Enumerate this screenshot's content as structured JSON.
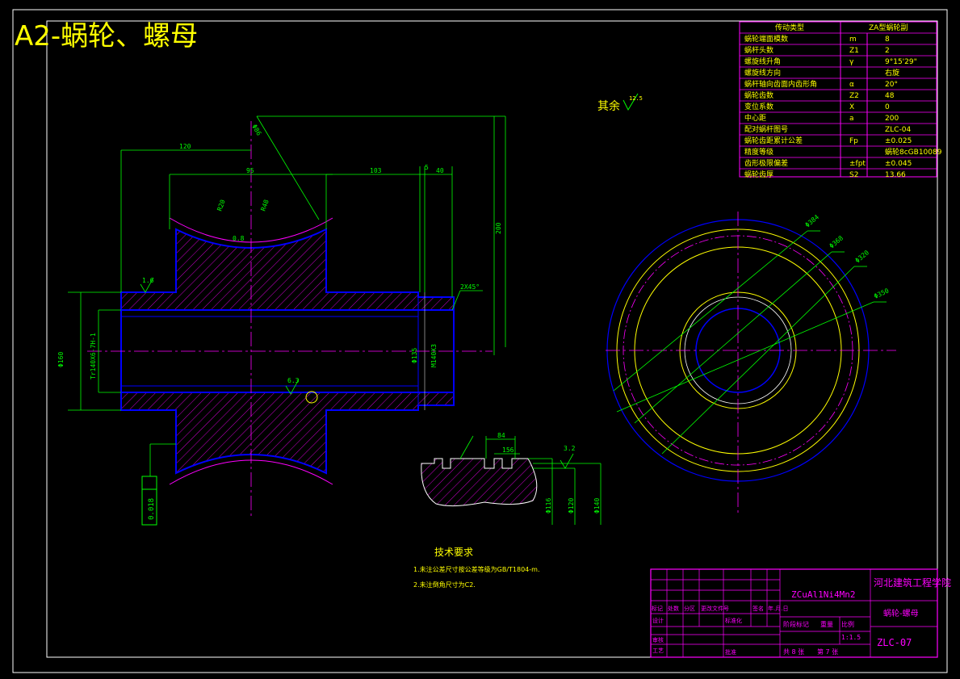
{
  "title": "A2-蜗轮、螺母",
  "colors": {
    "background": "#000000",
    "frame": "#ffffff",
    "table": "#ff00ff",
    "dimension": "#00ff00",
    "outline": "#0000ff",
    "hatch": "#ff00ff",
    "accent": "#ffff00",
    "centerline": "#ff00ff"
  },
  "params": {
    "header": [
      "传动类型",
      "ZA型蜗轮副"
    ],
    "rows": [
      [
        "蜗轮端面模数",
        "m",
        "8"
      ],
      [
        "蜗杆头数",
        "Z1",
        "2"
      ],
      [
        "螺旋线升角",
        "γ",
        "9°15'29\""
      ],
      [
        "螺旋线方向",
        "",
        "右旋"
      ],
      [
        "蜗杆轴向齿面内齿形角",
        "α",
        "20°"
      ],
      [
        "蜗轮齿数",
        "Z2",
        "48"
      ],
      [
        "变位系数",
        "X",
        "0"
      ],
      [
        "中心距",
        "a",
        "200"
      ],
      [
        "配对蜗杆图号",
        "",
        "ZLC-04"
      ],
      [
        "蜗轮齿距累计公差",
        "Fp",
        "±0.025"
      ],
      [
        "精度等级",
        "",
        "蜗轮8cGB10089"
      ],
      [
        "齿形极限偏差",
        "±fpt",
        "±0.045"
      ],
      [
        "蜗轮齿厚",
        "S2",
        "13.66"
      ]
    ]
  },
  "roughness_rest": {
    "label": "其余",
    "value": "12.5"
  },
  "dims": {
    "d120": "120",
    "d95": "95",
    "d103": "103",
    "d5": "5",
    "d40": "40",
    "d200": "200",
    "d16": "1.6",
    "chamfer": "2X45°",
    "bore_fit": "Tr140X6-7H-1",
    "dia_left": "Φ160",
    "dia135": "Φ135",
    "m140": "M140X3",
    "tol": "0.018",
    "rad_r": "R20",
    "r_sr": "R48",
    "rough_08": "0.8",
    "rough_63": "6.3",
    "d86": "Φ86",
    "detail_dims": [
      "84",
      "156",
      "3.2",
      "Φ116",
      "Φ120",
      "Φ140"
    ],
    "circle_labels": [
      "Φ384",
      "Φ368",
      "Φ320",
      "Φ350"
    ]
  },
  "tech": {
    "title": "技术要求",
    "items": [
      "1.未注公差尺寸按公差等级为GB/T1804-m.",
      "2.未注倒角尺寸为C2."
    ]
  },
  "titleblock": {
    "material": "ZCuAl1Ni4Mn2",
    "school": "河北建筑工程学院",
    "part_name": "蜗轮-螺母",
    "drawing_no": "ZLC-07",
    "scale": "1:1.5",
    "row_labels": [
      "标记",
      "处数",
      "分区",
      "更改文件号",
      "签名",
      "年.月.日"
    ],
    "design_labels": [
      "设计",
      "标准化"
    ],
    "check_labels": [
      "审核",
      "工艺"
    ],
    "approve_label": "批准",
    "stage_labels": [
      "阶段标记",
      "重量",
      "比例"
    ],
    "sheet_info": [
      "共 8 张",
      "第 7 张"
    ]
  }
}
